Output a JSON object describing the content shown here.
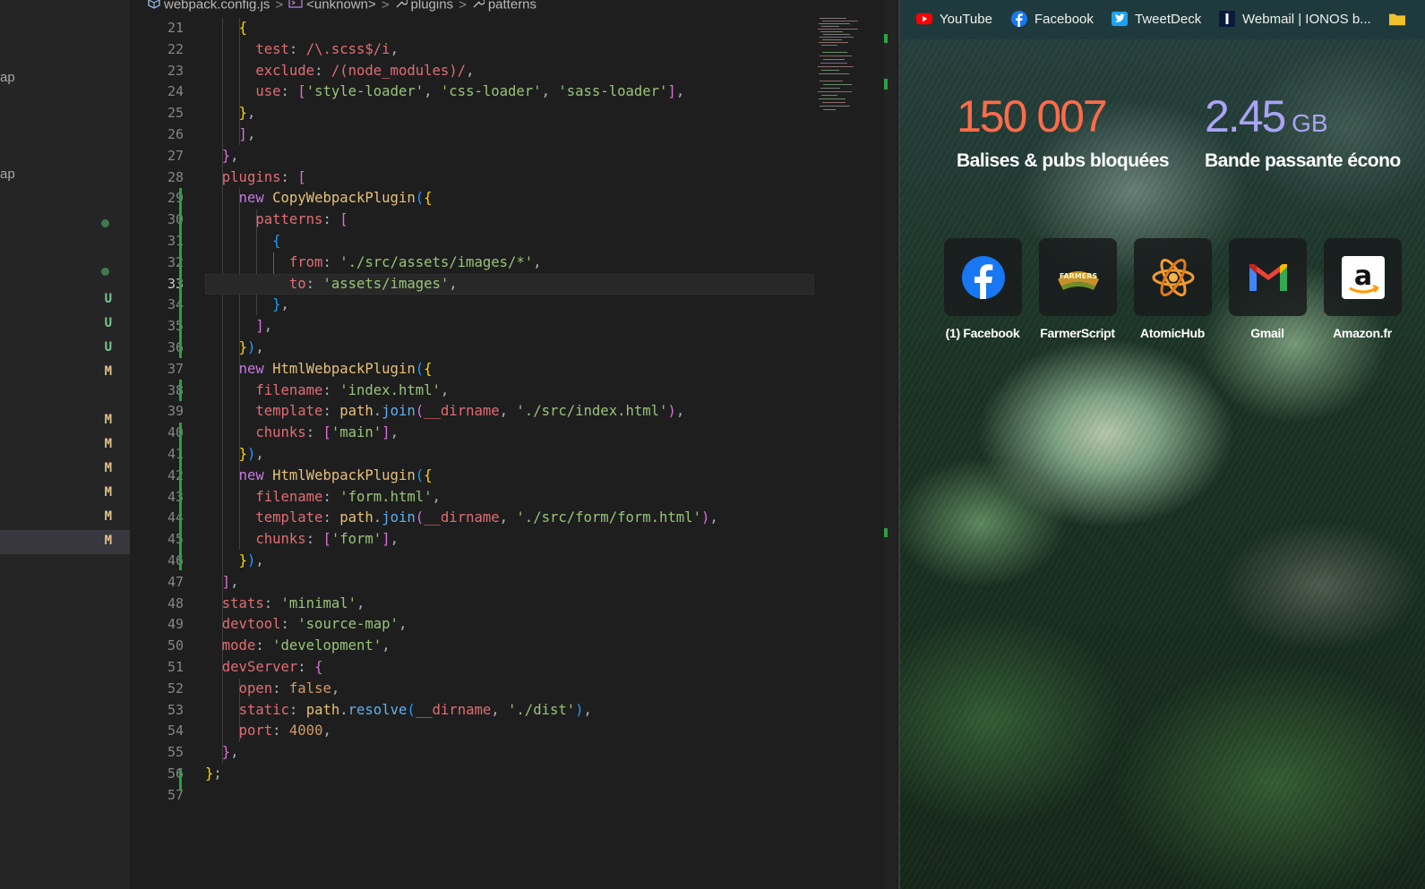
{
  "explorer": {
    "fragments": [
      "ap",
      "ap"
    ],
    "git_marks": [
      "U",
      "U",
      "U",
      "M",
      "M",
      "M",
      "M",
      "M",
      "M",
      "M"
    ],
    "colors": {
      "untracked": "#73c991",
      "modified": "#e2c08d",
      "dot": "#3f7a4d"
    }
  },
  "editor": {
    "breadcrumb": {
      "file": "webpack.config.js",
      "scope": "<unknown>",
      "plugins": "plugins",
      "patterns": "patterns"
    },
    "active_line": 33,
    "line_numbers": [
      "21",
      "22",
      "23",
      "24",
      "25",
      "26",
      "27",
      "28",
      "29",
      "30",
      "31",
      "32",
      "33",
      "34",
      "35",
      "36",
      "37",
      "38",
      "39",
      "40",
      "41",
      "42",
      "43",
      "44",
      "45",
      "46",
      "47",
      "48",
      "49",
      "50",
      "51",
      "52",
      "53",
      "54",
      "55",
      "56",
      "57"
    ],
    "lines": [
      [
        [
          "    ",
          "t-pun"
        ],
        [
          "{",
          "t-b1"
        ]
      ],
      [
        [
          "      ",
          "t-pun"
        ],
        [
          "test",
          "t-key"
        ],
        [
          ": ",
          "t-pun"
        ],
        [
          "/\\.scss$/i",
          "t-key"
        ],
        [
          ",",
          "t-pun"
        ]
      ],
      [
        [
          "      ",
          "t-pun"
        ],
        [
          "exclude",
          "t-key"
        ],
        [
          ": ",
          "t-pun"
        ],
        [
          "/(node_modules)/",
          "t-key"
        ],
        [
          ",",
          "t-pun"
        ]
      ],
      [
        [
          "      ",
          "t-pun"
        ],
        [
          "use",
          "t-key"
        ],
        [
          ": ",
          "t-pun"
        ],
        [
          "[",
          "t-b2"
        ],
        [
          "'style-loader'",
          "t-str"
        ],
        [
          ", ",
          "t-pun"
        ],
        [
          "'css-loader'",
          "t-str"
        ],
        [
          ", ",
          "t-pun"
        ],
        [
          "'sass-loader'",
          "t-str"
        ],
        [
          "]",
          "t-b2"
        ],
        [
          ",",
          "t-pun"
        ]
      ],
      [
        [
          "    ",
          "t-pun"
        ],
        [
          "}",
          "t-b1"
        ],
        [
          ",",
          "t-pun"
        ]
      ],
      [
        [
          "  ",
          "t-pun"
        ],
        [
          "  ]",
          "t-b2"
        ],
        [
          ",",
          "t-pun"
        ]
      ],
      [
        [
          "  ",
          "t-pun"
        ],
        [
          "}",
          "t-b2"
        ],
        [
          ",",
          "t-pun"
        ]
      ],
      [
        [
          "  ",
          "t-pun"
        ],
        [
          "plugins",
          "t-key"
        ],
        [
          ": ",
          "t-pun"
        ],
        [
          "[",
          "t-b2"
        ]
      ],
      [
        [
          "    ",
          "t-pun"
        ],
        [
          "new ",
          "t-kw"
        ],
        [
          "CopyWebpackPlugin",
          "t-cls"
        ],
        [
          "(",
          "t-b3"
        ],
        [
          "{",
          "t-b1"
        ]
      ],
      [
        [
          "      ",
          "t-pun"
        ],
        [
          "patterns",
          "t-key"
        ],
        [
          ": ",
          "t-pun"
        ],
        [
          "[",
          "t-b2"
        ]
      ],
      [
        [
          "        ",
          "t-pun"
        ],
        [
          "{",
          "t-b3"
        ]
      ],
      [
        [
          "          ",
          "t-pun"
        ],
        [
          "from",
          "t-key"
        ],
        [
          ": ",
          "t-pun"
        ],
        [
          "'./src/assets/images/*'",
          "t-str"
        ],
        [
          ",",
          "t-pun"
        ]
      ],
      [
        [
          "          ",
          "t-pun"
        ],
        [
          "to",
          "t-key"
        ],
        [
          ": ",
          "t-pun"
        ],
        [
          "'assets/images'",
          "t-str"
        ],
        [
          ",",
          "t-pun"
        ]
      ],
      [
        [
          "        ",
          "t-pun"
        ],
        [
          "}",
          "t-b3"
        ],
        [
          ",",
          "t-pun"
        ]
      ],
      [
        [
          "      ",
          "t-pun"
        ],
        [
          "]",
          "t-b2"
        ],
        [
          ",",
          "t-pun"
        ]
      ],
      [
        [
          "    ",
          "t-pun"
        ],
        [
          "}",
          "t-b1"
        ],
        [
          ")",
          "t-b3"
        ],
        [
          ",",
          "t-pun"
        ]
      ],
      [
        [
          "    ",
          "t-pun"
        ],
        [
          "new ",
          "t-kw"
        ],
        [
          "HtmlWebpackPlugin",
          "t-cls"
        ],
        [
          "(",
          "t-b3"
        ],
        [
          "{",
          "t-b1"
        ]
      ],
      [
        [
          "      ",
          "t-pun"
        ],
        [
          "filename",
          "t-key"
        ],
        [
          ": ",
          "t-pun"
        ],
        [
          "'index.html'",
          "t-str"
        ],
        [
          ",",
          "t-pun"
        ]
      ],
      [
        [
          "      ",
          "t-pun"
        ],
        [
          "template",
          "t-key"
        ],
        [
          ": ",
          "t-pun"
        ],
        [
          "path",
          "t-cls"
        ],
        [
          ".",
          "t-pun"
        ],
        [
          "join",
          "t-fn"
        ],
        [
          "(",
          "t-b2"
        ],
        [
          "__dirname",
          "t-key"
        ],
        [
          ", ",
          "t-pun"
        ],
        [
          "'./src/index.html'",
          "t-str"
        ],
        [
          ")",
          "t-b2"
        ],
        [
          ",",
          "t-pun"
        ]
      ],
      [
        [
          "      ",
          "t-pun"
        ],
        [
          "chunks",
          "t-key"
        ],
        [
          ": ",
          "t-pun"
        ],
        [
          "[",
          "t-b2"
        ],
        [
          "'main'",
          "t-str"
        ],
        [
          "]",
          "t-b2"
        ],
        [
          ",",
          "t-pun"
        ]
      ],
      [
        [
          "    ",
          "t-pun"
        ],
        [
          "}",
          "t-b1"
        ],
        [
          ")",
          "t-b3"
        ],
        [
          ",",
          "t-pun"
        ]
      ],
      [
        [
          "    ",
          "t-pun"
        ],
        [
          "new ",
          "t-kw"
        ],
        [
          "HtmlWebpackPlugin",
          "t-cls"
        ],
        [
          "(",
          "t-b3"
        ],
        [
          "{",
          "t-b1"
        ]
      ],
      [
        [
          "      ",
          "t-pun"
        ],
        [
          "filename",
          "t-key"
        ],
        [
          ": ",
          "t-pun"
        ],
        [
          "'form.html'",
          "t-str"
        ],
        [
          ",",
          "t-pun"
        ]
      ],
      [
        [
          "      ",
          "t-pun"
        ],
        [
          "template",
          "t-key"
        ],
        [
          ": ",
          "t-pun"
        ],
        [
          "path",
          "t-cls"
        ],
        [
          ".",
          "t-pun"
        ],
        [
          "join",
          "t-fn"
        ],
        [
          "(",
          "t-b2"
        ],
        [
          "__dirname",
          "t-key"
        ],
        [
          ", ",
          "t-pun"
        ],
        [
          "'./src/form/form.html'",
          "t-str"
        ],
        [
          ")",
          "t-b2"
        ],
        [
          ",",
          "t-pun"
        ]
      ],
      [
        [
          "      ",
          "t-pun"
        ],
        [
          "chunks",
          "t-key"
        ],
        [
          ": ",
          "t-pun"
        ],
        [
          "[",
          "t-b2"
        ],
        [
          "'form'",
          "t-str"
        ],
        [
          "]",
          "t-b2"
        ],
        [
          ",",
          "t-pun"
        ]
      ],
      [
        [
          "    ",
          "t-pun"
        ],
        [
          "}",
          "t-b1"
        ],
        [
          ")",
          "t-b3"
        ],
        [
          ",",
          "t-pun"
        ]
      ],
      [
        [
          "  ",
          "t-pun"
        ],
        [
          "]",
          "t-b2"
        ],
        [
          ",",
          "t-pun"
        ]
      ],
      [
        [
          "  ",
          "t-pun"
        ],
        [
          "stats",
          "t-key"
        ],
        [
          ": ",
          "t-pun"
        ],
        [
          "'minimal'",
          "t-str"
        ],
        [
          ",",
          "t-pun"
        ]
      ],
      [
        [
          "  ",
          "t-pun"
        ],
        [
          "devtool",
          "t-key"
        ],
        [
          ": ",
          "t-pun"
        ],
        [
          "'source-map'",
          "t-str"
        ],
        [
          ",",
          "t-pun"
        ]
      ],
      [
        [
          "  ",
          "t-pun"
        ],
        [
          "mode",
          "t-key"
        ],
        [
          ": ",
          "t-pun"
        ],
        [
          "'development'",
          "t-str"
        ],
        [
          ",",
          "t-pun"
        ]
      ],
      [
        [
          "  ",
          "t-pun"
        ],
        [
          "devServer",
          "t-key"
        ],
        [
          ": ",
          "t-pun"
        ],
        [
          "{",
          "t-b2"
        ]
      ],
      [
        [
          "    ",
          "t-pun"
        ],
        [
          "open",
          "t-key"
        ],
        [
          ": ",
          "t-pun"
        ],
        [
          "false",
          "t-num"
        ],
        [
          ",",
          "t-pun"
        ]
      ],
      [
        [
          "    ",
          "t-pun"
        ],
        [
          "static",
          "t-key"
        ],
        [
          ": ",
          "t-pun"
        ],
        [
          "path",
          "t-cls"
        ],
        [
          ".",
          "t-pun"
        ],
        [
          "resolve",
          "t-fn"
        ],
        [
          "(",
          "t-b3"
        ],
        [
          "__dirname",
          "t-key"
        ],
        [
          ", ",
          "t-pun"
        ],
        [
          "'./dist'",
          "t-str"
        ],
        [
          ")",
          "t-b3"
        ],
        [
          ",",
          "t-pun"
        ]
      ],
      [
        [
          "    ",
          "t-pun"
        ],
        [
          "port",
          "t-key"
        ],
        [
          ": ",
          "t-pun"
        ],
        [
          "4000",
          "t-num"
        ],
        [
          ",",
          "t-pun"
        ]
      ],
      [
        [
          "  ",
          "t-pun"
        ],
        [
          "}",
          "t-b2"
        ],
        [
          ",",
          "t-pun"
        ]
      ],
      [
        [
          "}",
          "t-b1"
        ],
        [
          ";",
          "t-pun"
        ]
      ],
      [
        [
          "",
          "t-pun"
        ]
      ]
    ]
  },
  "browser": {
    "bookmarks": [
      {
        "label": "YouTube",
        "icon": "youtube-icon"
      },
      {
        "label": "Facebook",
        "icon": "facebook-icon"
      },
      {
        "label": "TweetDeck",
        "icon": "twitter-icon"
      },
      {
        "label": "Webmail | IONOS b...",
        "icon": "ionos-icon"
      },
      {
        "label": "",
        "icon": "folder-icon"
      }
    ],
    "stats": [
      {
        "value": "150 007",
        "unit": "",
        "label": "Balises & pubs bloquées",
        "color": "#ff6b4a"
      },
      {
        "value": "2.45",
        "unit": " GB",
        "label": "Bande passante écono",
        "color": "#a9a4f5"
      }
    ],
    "shortcuts": [
      {
        "label": "(1) Facebook",
        "icon": "facebook-icon"
      },
      {
        "label": "FarmerScript",
        "icon": "farmerscript-icon"
      },
      {
        "label": "AtomicHub",
        "icon": "atomichub-icon"
      },
      {
        "label": "Gmail",
        "icon": "gmail-icon"
      },
      {
        "label": "Amazon.fr",
        "icon": "amazon-icon"
      }
    ]
  }
}
